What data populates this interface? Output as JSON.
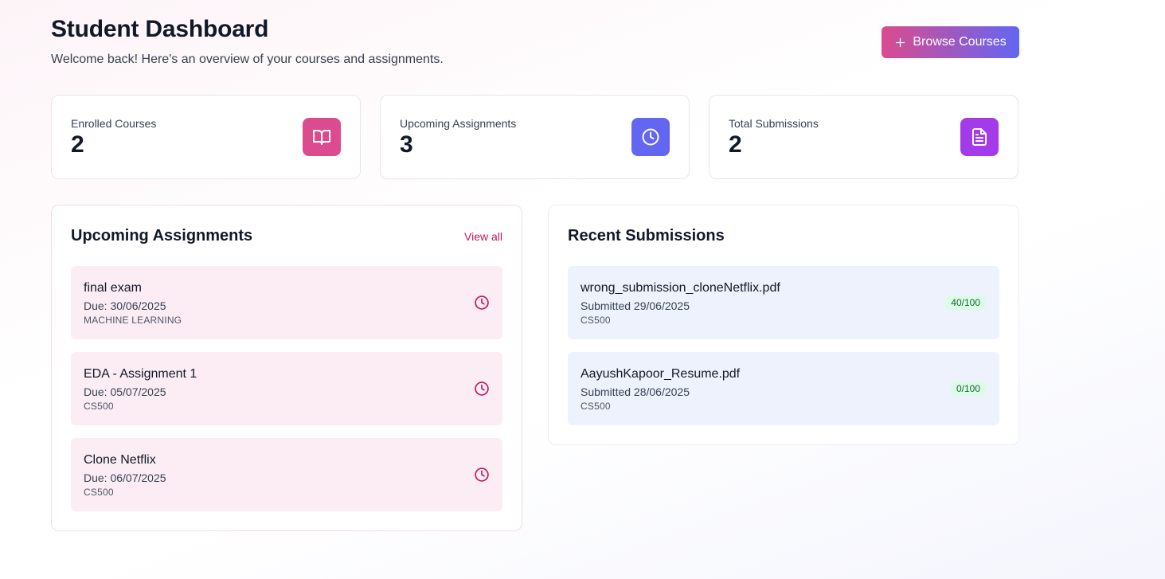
{
  "header": {
    "title": "Student Dashboard",
    "subtitle": "Welcome back! Here's an overview of your courses and assignments.",
    "browse_label": "Browse Courses",
    "browse_icon": "plus-icon"
  },
  "stats": [
    {
      "label": "Enrolled Courses",
      "value": "2",
      "icon": "book-open-icon",
      "color": "#db4b8f"
    },
    {
      "label": "Upcoming Assignments",
      "value": "3",
      "icon": "clock-icon",
      "color": "#6366f1"
    },
    {
      "label": "Total Submissions",
      "value": "2",
      "icon": "file-text-icon",
      "color": "#a33be8"
    }
  ],
  "upcoming": {
    "title": "Upcoming Assignments",
    "view_all": "View all",
    "items": [
      {
        "title": "final exam",
        "due": "Due: 30/06/2025",
        "course": "MACHINE LEARNING",
        "icon": "clock-icon"
      },
      {
        "title": "EDA - Assignment 1",
        "due": "Due: 05/07/2025",
        "course": "CS500",
        "icon": "clock-icon"
      },
      {
        "title": "Clone Netflix",
        "due": "Due: 06/07/2025",
        "course": "CS500",
        "icon": "clock-icon"
      }
    ]
  },
  "submissions": {
    "title": "Recent Submissions",
    "items": [
      {
        "file": "wrong_submission_cloneNetflix.pdf",
        "submitted": "Submitted 29/06/2025",
        "course": "CS500",
        "score": "40/100"
      },
      {
        "file": "AayushKapoor_Resume.pdf",
        "submitted": "Submitted 28/06/2025",
        "course": "CS500",
        "score": "0/100"
      }
    ]
  },
  "colors": {
    "accent": "#be185d",
    "score_bg": "#dcfce7",
    "score_text": "#166534"
  }
}
